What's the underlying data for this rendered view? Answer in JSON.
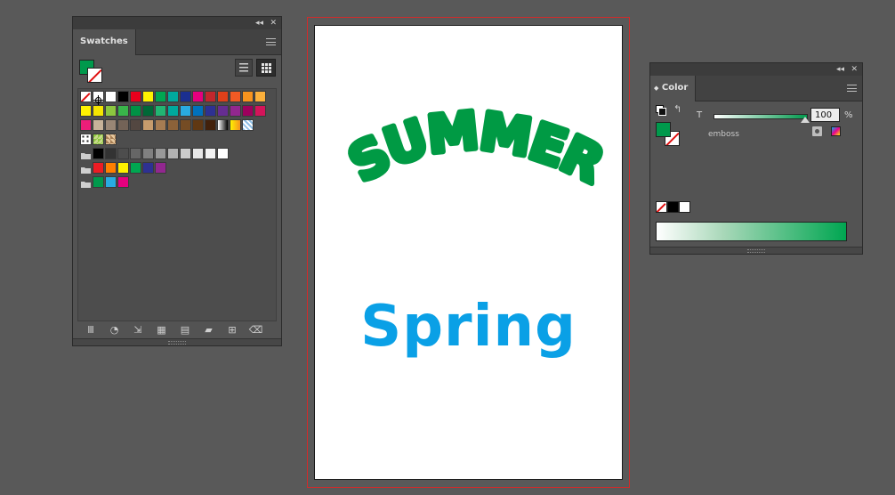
{
  "swatches_panel": {
    "tab_label": "Swatches",
    "collapse_glyph": "◂◂",
    "close_glyph": "✕",
    "fill_color": "#00994c",
    "swatch_rows": [
      [
        "none",
        "registration",
        "#ffffff",
        "#000000",
        "#e8001c",
        "#fff200",
        "#00a651",
        "#00a99d",
        "#1b2f90",
        "#e5007e",
        "#c1272d",
        "#e0401a",
        "#f15a24",
        "#f7931e",
        "#fbb03b"
      ],
      [
        "#fff200",
        "#f5e500",
        "#8cc63f",
        "#39b54a",
        "#009245",
        "#006837",
        "#22b573",
        "#00a99d",
        "#29abe2",
        "#0071bc",
        "#2e3192",
        "#662d91",
        "#93278f",
        "#9e005d",
        "#d4145a"
      ],
      [
        "#ed1e79",
        "#c7b299",
        "#998675",
        "#736357",
        "#534741",
        "#c69c6d",
        "#a67c52",
        "#8c6239",
        "#754c24",
        "#603813",
        "#42210b",
        "gradient-bw",
        "gradient-yellow",
        "pattern-blue"
      ],
      [
        "pattern-dots",
        "pattern-leaf",
        "pattern-tiles"
      ],
      [
        "folder",
        "#000000",
        "#333333",
        "#4d4d4d",
        "#666666",
        "#808080",
        "#999999",
        "#b3b3b3",
        "#cccccc",
        "#e6e6e6",
        "#f2f2f2",
        "#ffffff"
      ],
      [
        "folder",
        "#ed1c24",
        "#ff7f00",
        "#fff200",
        "#00a651",
        "#2e3192",
        "#92278f"
      ],
      [
        "folder",
        "#00994c",
        "#29abe2",
        "#e5007e"
      ]
    ],
    "bottom_tools": [
      "library-icon",
      "show-kinds-icon",
      "place-swatch-icon",
      "swatch-options-icon",
      "color-group-icon",
      "new-group-icon",
      "new-swatch-icon",
      "delete-icon"
    ]
  },
  "artboard": {
    "headline": "SUMMER",
    "headline_color": "#009a44",
    "subtitle": "Spring",
    "subtitle_color": "#0aa0e6"
  },
  "color_panel": {
    "tab_label": "Color",
    "collapse_glyph": "◂◂",
    "close_glyph": "✕",
    "slider_label": "T",
    "tint_value": "100",
    "unit": "%",
    "swatch_name": "emboss",
    "fill_color": "#00994c",
    "gradient_end": "#00a651"
  }
}
